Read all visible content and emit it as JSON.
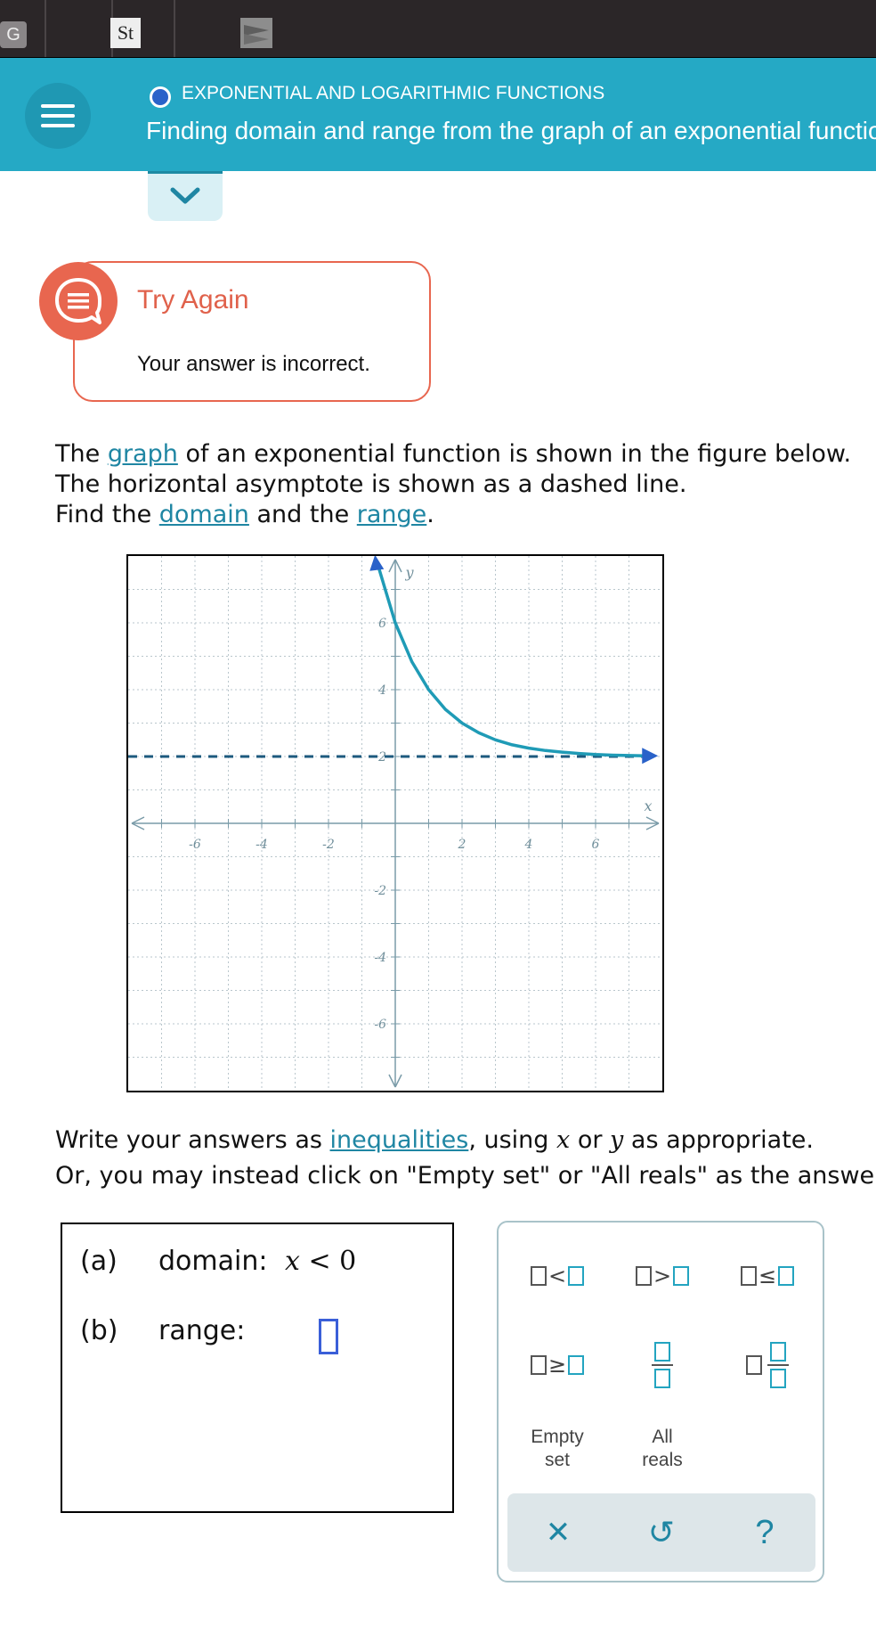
{
  "browser": {
    "tabs": [
      {
        "label": "G"
      },
      {
        "label": "St"
      },
      {
        "label": ""
      }
    ]
  },
  "header": {
    "topic": "EXPONENTIAL AND LOGARITHMIC FUNCTIONS",
    "title": "Finding domain and range from the graph of an exponential function"
  },
  "feedback": {
    "title": "Try Again",
    "message": "Your answer is incorrect."
  },
  "problem": {
    "line1_pre": "The ",
    "line1_link": "graph",
    "line1_post": " of an exponential function is shown in the figure below.",
    "line2": "The horizontal asymptote is shown as a dashed line.",
    "line3_pre": "Find the ",
    "line3_link1": "domain",
    "line3_mid": " and the ",
    "line3_link2": "range",
    "line3_post": "."
  },
  "chart_data": {
    "type": "line",
    "xlim": [
      -8,
      8
    ],
    "ylim": [
      -8,
      8
    ],
    "grid": true,
    "xlabel": "x",
    "ylabel": "y",
    "x_ticks": [
      -6,
      -4,
      -2,
      2,
      4,
      6
    ],
    "y_ticks": [
      6,
      4,
      2,
      -2,
      -4,
      -6
    ],
    "x_tick_labels": [
      "-6",
      "-4",
      "-2",
      "2",
      "4",
      "6"
    ],
    "y_tick_labels": [
      "6",
      "4",
      "2",
      "-2",
      "-4",
      "-6"
    ],
    "asymptote_y": 2,
    "series": [
      {
        "x": [
          -0.5,
          0,
          0.5,
          1,
          1.5,
          2,
          2.5,
          3,
          3.5,
          4,
          4.5,
          5,
          5.5,
          6,
          6.5,
          7,
          7.5
        ],
        "y": [
          7.66,
          6,
          4.83,
          4,
          3.41,
          3,
          2.71,
          2.5,
          2.35,
          2.25,
          2.18,
          2.13,
          2.09,
          2.06,
          2.04,
          2.03,
          2.02
        ]
      }
    ],
    "colors": {
      "curve": "#1f9bb6",
      "arrow": "#2a62c9",
      "axis": "#7a9ba8",
      "grid": "#b9c6cc",
      "asymptote": "#1d5a7e"
    }
  },
  "instructions": {
    "line1_pre": "Write your answers as ",
    "line1_link": "inequalities",
    "line1_mid": ", using ",
    "var_x": "x",
    "or": " or ",
    "var_y": "y",
    "line1_post": " as appropriate.",
    "line2": "Or, you may instead click on \"Empty set\" or \"All reals\" as the answer."
  },
  "answers": {
    "a_label": "(a)",
    "a_name": "domain:",
    "a_var": "x",
    "a_op": "<",
    "a_val": "0",
    "b_label": "(b)",
    "b_name": "range:"
  },
  "keypad": {
    "lt": "<",
    "gt": ">",
    "le": "≤",
    "ge": "≥",
    "empty_1": "Empty",
    "empty_2": "set",
    "reals_1": "All",
    "reals_2": "reals",
    "clear": "✕",
    "undo": "↺",
    "help": "?"
  }
}
